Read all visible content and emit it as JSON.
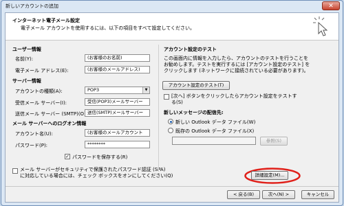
{
  "window": {
    "title": "新しいアカウントの追加"
  },
  "header": {
    "title": "インターネット電子メール設定",
    "subtitle": "電子メール アカウントを使用するには、以下の項目をすべて設定してください。"
  },
  "user_info": {
    "section": "ユーザー情報",
    "name_label": "名前(Y):",
    "name_value": "(お客様のお名前)",
    "email_label": "電子メール アドレス(E):",
    "email_value": "(お客様のメールアドレス)"
  },
  "server_info": {
    "section": "サーバー情報",
    "account_type_label": "アカウントの種類(A):",
    "account_type_value": "POP3",
    "incoming_label": "受信メール サーバー(I):",
    "incoming_value": "受信(POP3)メールサーバー",
    "outgoing_label": "送信メール サーバー (SMTP)(O):",
    "outgoing_value": "送信(SMTP)メールサーバー"
  },
  "login_info": {
    "section": "メール サーバーへのログオン情報",
    "account_label": "アカウント名(U):",
    "account_value": "(お客様のメールアカウント",
    "password_label": "パスワード(P):",
    "password_value": "********",
    "remember_label": "パスワードを保存する(R)",
    "remember_checked": true,
    "spa_label_line1": "メール サーバーがセキュリティで保護されたパスワード認証 (SPA)",
    "spa_label_line2": "に対応している場合には、チェック ボックスをオンにしてください(Q)",
    "spa_checked": false
  },
  "test": {
    "section": "アカウント設定のテスト",
    "desc_line1": "この画面内に情報を入力したら、アカウントのテストを行うことを",
    "desc_line2": "お勧めします。テストを実行するには [アカウント設定のテスト] を",
    "desc_line3": "クリックします (ネットワークに接続されている必要があります)。",
    "test_button": "アカウント設定のテスト(T)",
    "next_check_line1": "[次へ] ボタンをクリックしたらアカウント設定をテストす",
    "next_check_line2": "る(S)",
    "next_check_checked": false
  },
  "delivery": {
    "section": "新しいメッセージの配信先:",
    "new_file_label": "新しい Outlook データ ファイル(W)",
    "existing_file_label": "既存の Outlook データ ファイル(X)",
    "selected": "new",
    "browse_button": "参照(S)"
  },
  "more_settings_button": "詳細設定(M)...",
  "footer": {
    "back": "< 戻る(B)",
    "next": "次へ(N) >",
    "cancel": "キャンセル"
  },
  "colors": {
    "highlight_ring": "#e0201a",
    "title_bar": "#c9d9ea",
    "close_button": "#c8452f"
  }
}
